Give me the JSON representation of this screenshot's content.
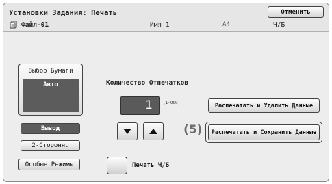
{
  "dialog": {
    "title": "Установки Задания: Печать",
    "cancel_label": "Отменить"
  },
  "file": {
    "icon": "file-icon",
    "name": "Файл-01",
    "job_name": "Имя 1",
    "paper_size": "A4",
    "color_mode": "Ч/Б"
  },
  "paper": {
    "label": "Выбор Бумаги",
    "value": "Авто"
  },
  "left_buttons": {
    "output": "Вывод",
    "duplex": "2-Сторонн.",
    "special": "Особые Режимы"
  },
  "copies": {
    "label": "Количество Отпечатков",
    "value": "1",
    "range": "(1~999)"
  },
  "bw": {
    "label": "Печать Ч/Б"
  },
  "actions": {
    "print_delete": "Распечатать и Удалить Данные",
    "print_save": "Распечатать и Сохранить Данные"
  },
  "callout": "(5)"
}
